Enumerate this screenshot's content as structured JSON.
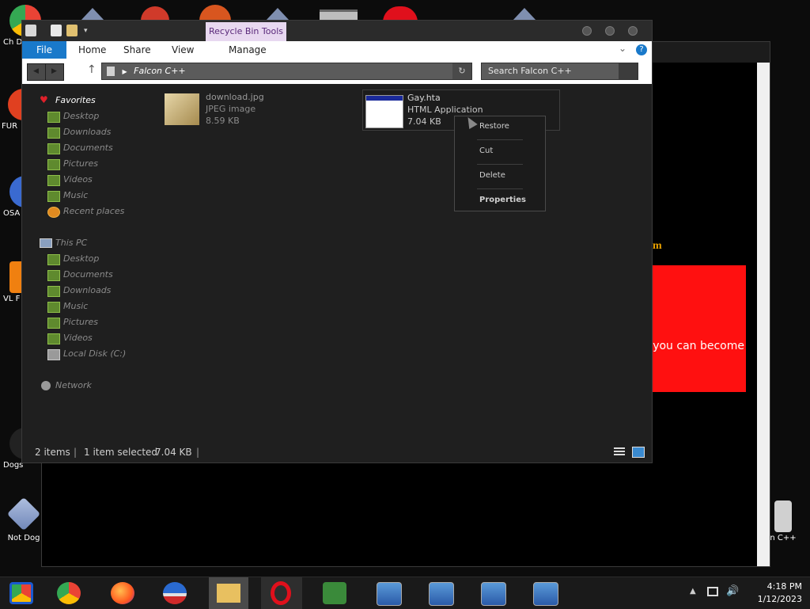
{
  "desktop": {
    "icons": [
      {
        "label": "Ch D",
        "icon": "chrome-icon"
      },
      {
        "label": "FUR",
        "icon": "app-icon"
      },
      {
        "label": "OSA LAD",
        "icon": "app-icon"
      },
      {
        "label": "VL F",
        "icon": "vlc-icon"
      },
      {
        "label": "Dogs",
        "icon": "app-icon"
      },
      {
        "label": "Not Dog",
        "icon": "app-icon"
      },
      {
        "label": "n C++",
        "icon": "recycle-bin-icon"
      }
    ]
  },
  "background_window": {
    "fragment1": "m",
    "redbox_text": "r you can become"
  },
  "explorer": {
    "context_tab": "Recycle Bin Tools",
    "ribbon_tabs": [
      "File",
      "Home",
      "Share",
      "View",
      "Manage"
    ],
    "address": "Falcon C++",
    "search_placeholder": "Search Falcon C++",
    "favorites_label": "Favorites",
    "favorites": [
      "Desktop",
      "Downloads",
      "Documents",
      "Pictures",
      "Videos",
      "Music",
      "Recent places"
    ],
    "this_pc_label": "This PC",
    "this_pc": [
      "Desktop",
      "Documents",
      "Downloads",
      "Music",
      "Pictures",
      "Videos",
      "Local Disk (C:)"
    ],
    "network_label": "Network",
    "files": [
      {
        "name": "download.jpg",
        "type": "JPEG image",
        "size": "8.59 KB",
        "icon": "image-icon"
      },
      {
        "name": "Gay.hta",
        "type": "HTML Application",
        "size": "7.04 KB",
        "icon": "hta-icon"
      }
    ],
    "context_menu": [
      "Restore",
      "Cut",
      "Delete",
      "Properties"
    ],
    "status": {
      "count": "2 items",
      "selected": "1 item selected",
      "size": "7.04 KB"
    }
  },
  "taskbar": {
    "time": "4:18 PM",
    "date": "1/12/2023"
  },
  "colors": {
    "file_tab": "#1979ca",
    "context_tab": "#e8d8f0",
    "redbox": "#ff1010",
    "desktop": "#0c0c0c"
  }
}
